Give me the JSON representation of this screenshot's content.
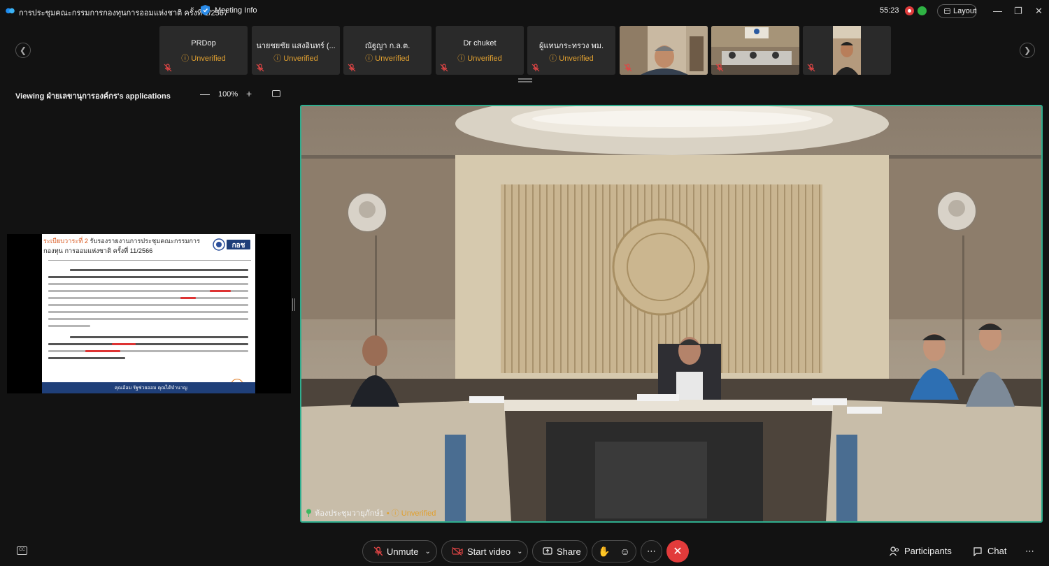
{
  "window": {
    "title": "การประชุมคณะกรรมการกองทุนการออมแห่งชาติ ครั้งที่ 1/2567",
    "meeting_info_label": "Meeting Info",
    "timer": "55:23",
    "layout_label": "Layout"
  },
  "participants_strip": [
    {
      "name": "PRDop",
      "status": "Unverified",
      "muted": true
    },
    {
      "name": "นายชยชัย แสงอินทร์ (...",
      "status": "Unverified",
      "muted": true
    },
    {
      "name": "ณัฐญา  ก.ล.ต.",
      "status": "Unverified",
      "muted": true
    },
    {
      "name": "Dr chuket",
      "status": "Unverified",
      "muted": true
    },
    {
      "name": "ผู้แทนกระทรวง พม.",
      "status": "Unverified",
      "muted": true
    },
    {
      "name": "",
      "status": "",
      "muted": true,
      "video": "person-1"
    },
    {
      "name": "",
      "status": "",
      "muted": true,
      "video": "room-2"
    },
    {
      "name": "",
      "status": "",
      "muted": true,
      "video": "person-3"
    }
  ],
  "share_bar": {
    "viewing_text": "Viewing ฝ่ายเลขานุการองค์กร's applications",
    "zoom_level": "100%"
  },
  "slide": {
    "agenda_prefix": "ระเบียบวาระที่ 2",
    "heading": " รับรองรายงานการประชุมคณะกรรมการกองทุน การออมแห่งชาติ ครั้งที่ 11/2566",
    "logo_text": "กอช",
    "footer": "คุณอ้อม รัฐช่วยออม คุณได้บำนาญ",
    "page_number": "7"
  },
  "main_video": {
    "participant_name": "ห้องประชุมวายุภักษ์1",
    "status": "Unverified"
  },
  "controls": {
    "unmute": "Unmute",
    "start_video": "Start video",
    "share": "Share",
    "participants": "Participants",
    "chat": "Chat"
  }
}
